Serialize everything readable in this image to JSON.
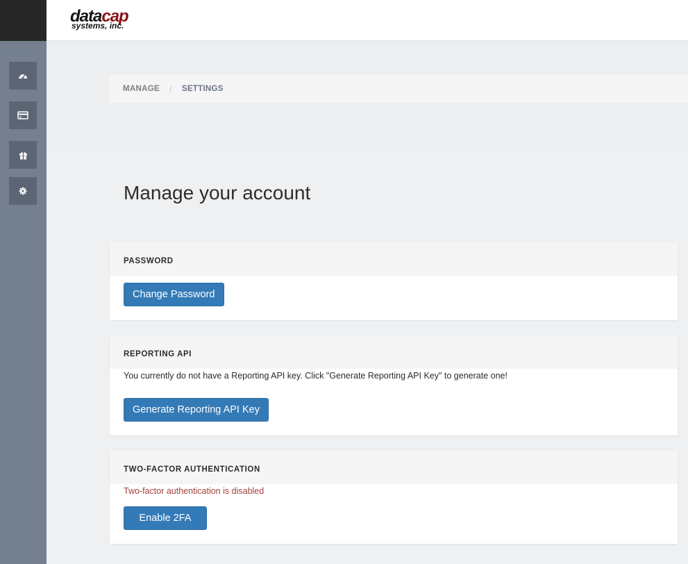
{
  "logo": {
    "line1_part1": "data",
    "line1_part2": "cap",
    "line2": "systems, inc."
  },
  "sidebar": {
    "items": [
      {
        "name": "dashboard",
        "icon": "tachometer-icon"
      },
      {
        "name": "transactions",
        "icon": "credit-card-icon"
      },
      {
        "name": "gift",
        "icon": "gift-icon"
      },
      {
        "name": "settings",
        "icon": "gear-icon"
      }
    ]
  },
  "breadcrumb": {
    "items": [
      "MANAGE",
      "SETTINGS"
    ],
    "separator": "/"
  },
  "page": {
    "title": "Manage your account"
  },
  "password": {
    "title": "PASSWORD",
    "button": "Change Password"
  },
  "reporting": {
    "title": "REPORTING API",
    "message": "You currently do not have a Reporting API key. Click \"Generate Reporting API Key\" to generate one!",
    "button": "Generate Reporting API Key"
  },
  "twofa": {
    "title": "TWO-FACTOR AUTHENTICATION",
    "status": "Two-factor authentication is disabled",
    "button": "Enable 2FA"
  },
  "colors": {
    "primary": "#337ab7",
    "sidebar": "#74808f",
    "sidebar_button": "#5c6573",
    "warning_text": "#a2403c",
    "logo_red": "#8a1216"
  }
}
